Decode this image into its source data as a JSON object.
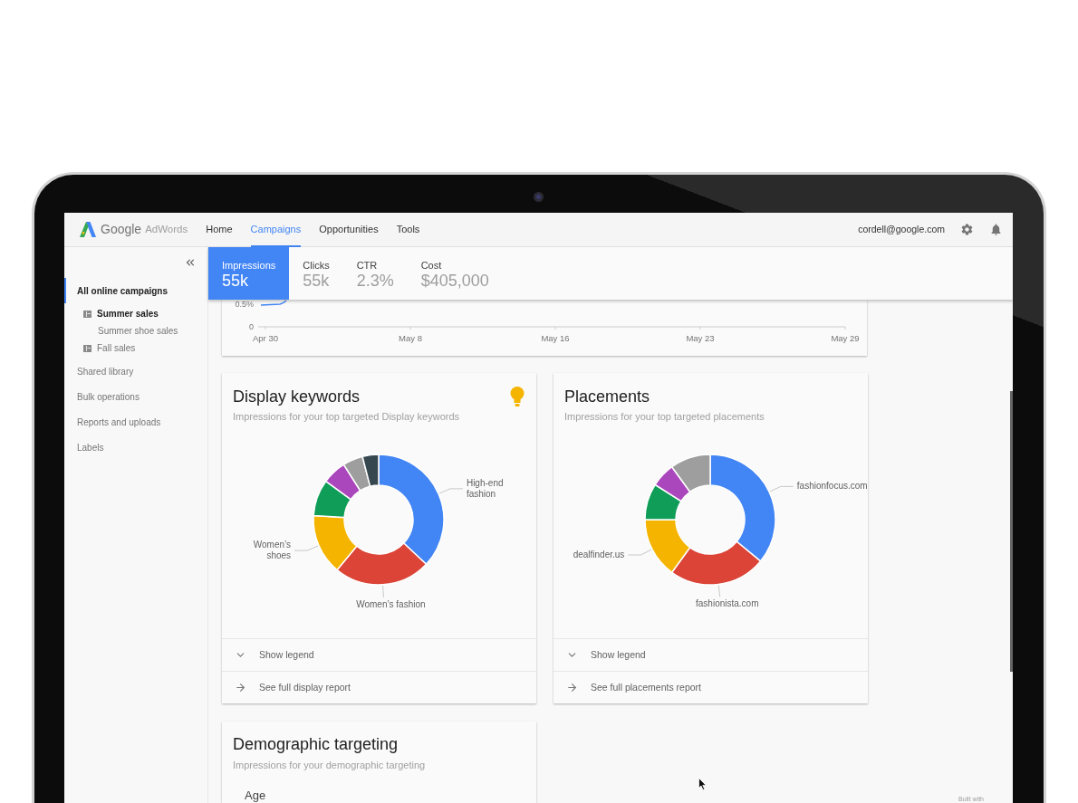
{
  "top_bar": {
    "brand": {
      "name": "Google",
      "product": "AdWords"
    },
    "nav": [
      {
        "label": "Home",
        "selected": false
      },
      {
        "label": "Campaigns",
        "selected": true
      },
      {
        "label": "Opportunities",
        "selected": false
      },
      {
        "label": "Tools",
        "selected": false
      }
    ],
    "account": "cordell@google.com"
  },
  "sidebar": {
    "items": [
      {
        "label": "All online campaigns",
        "selected": true,
        "children": [
          {
            "label": "Summer sales",
            "kind": "campaign",
            "expanded": true,
            "children": [
              {
                "label": "Summer shoe sales",
                "kind": "ad_group"
              }
            ]
          },
          {
            "label": "Fall sales",
            "kind": "campaign",
            "expanded": false
          }
        ]
      },
      {
        "label": "Shared library",
        "selected": false
      },
      {
        "label": "Bulk operations",
        "selected": false
      },
      {
        "label": "Reports and uploads",
        "selected": false
      },
      {
        "label": "Labels",
        "selected": false
      }
    ]
  },
  "metrics": [
    {
      "label": "Impressions",
      "value": "55k",
      "selected": true
    },
    {
      "label": "Clicks",
      "value": "55k",
      "selected": false
    },
    {
      "label": "CTR",
      "value": "2.3%",
      "selected": false
    },
    {
      "label": "Cost",
      "value": "$405,000",
      "selected": false
    }
  ],
  "performance_chart": {
    "y_labels": [
      "0.5%",
      "0"
    ],
    "x_labels": [
      "Apr 30",
      "May 8",
      "May 16",
      "May 23",
      "May 29"
    ]
  },
  "cards": [
    {
      "title": "Display keywords",
      "subtitle": "Impressions for your top targeted Display keywords",
      "insight": true,
      "chart_data": {
        "type": "donut",
        "categories": [
          "High-end fashion",
          "Women’s fashion",
          "Women’s shoes",
          null,
          null,
          null,
          null
        ],
        "values": [
          37,
          24,
          15,
          9,
          6,
          5,
          4
        ],
        "colors": [
          "#4285f4",
          "#db4437",
          "#f4b400",
          "#0f9d58",
          "#ab47bc",
          "#9e9e9e",
          "#37474f"
        ]
      },
      "actions": [
        {
          "label": "Show legend",
          "kind": "expand"
        },
        {
          "label": "See full display report",
          "kind": "link"
        }
      ]
    },
    {
      "title": "Placements",
      "subtitle": "Impressions for your top targeted placements",
      "insight": false,
      "chart_data": {
        "type": "donut",
        "categories": [
          "fashionfocus.com",
          "fashionista.com",
          "dealfinder.us",
          null,
          null,
          null
        ],
        "values": [
          36,
          24,
          15,
          9,
          6,
          10
        ],
        "colors": [
          "#4285f4",
          "#db4437",
          "#f4b400",
          "#0f9d58",
          "#ab47bc",
          "#9e9e9e"
        ]
      },
      "actions": [
        {
          "label": "Show legend",
          "kind": "expand"
        },
        {
          "label": "See full placements report",
          "kind": "link"
        }
      ]
    }
  ],
  "demographic_card": {
    "title": "Demographic targeting",
    "subtitle": "Impressions for your demographic targeting",
    "section": "Age"
  },
  "footer_note": "Built with"
}
